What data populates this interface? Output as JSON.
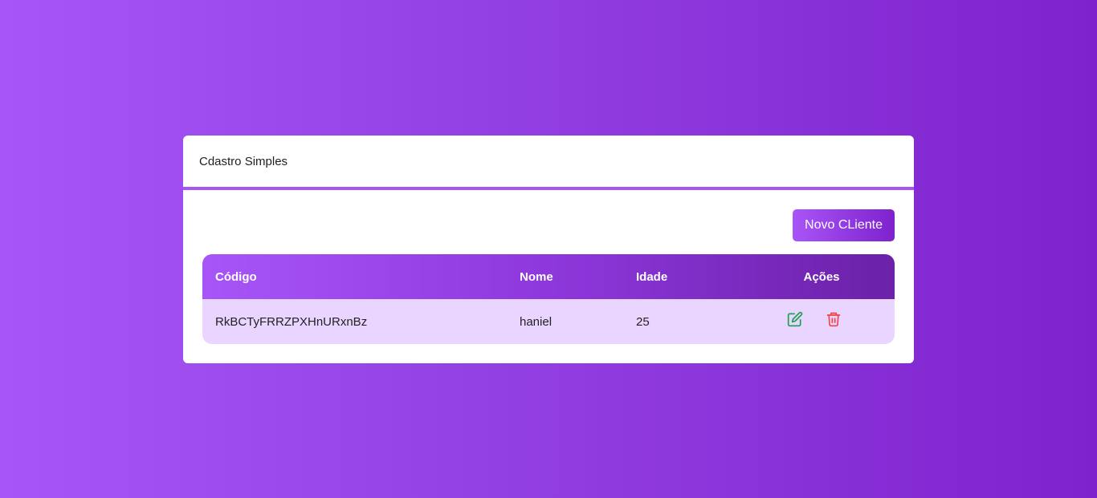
{
  "card": {
    "title": "Cdastro Simples"
  },
  "toolbar": {
    "new_label": "Novo CLiente"
  },
  "table": {
    "columns": [
      "Código",
      "Nome",
      "Idade",
      "Ações"
    ],
    "rows": [
      {
        "codigo": "RkBCTyFRRZPXHnURxnBz",
        "nome": "haniel",
        "idade": "25",
        "actions": [
          "edit-icon",
          "trash-icon"
        ]
      }
    ]
  },
  "colors": {
    "accent": "#a855f7",
    "accent_dark": "#7e22ce",
    "row_bg": "#e9d5ff",
    "edit": "#16a34a",
    "delete": "#ef4444"
  }
}
